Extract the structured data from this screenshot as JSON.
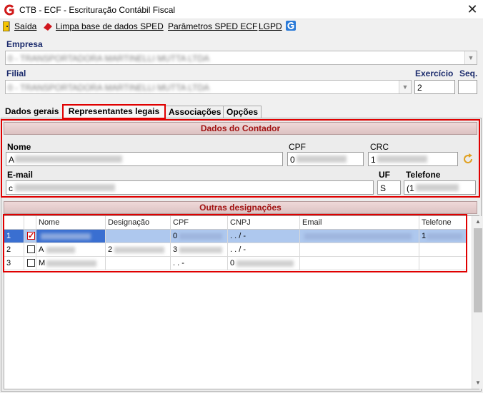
{
  "window": {
    "title": "CTB - ECF - Escrituração Contábil Fiscal",
    "close_label": "✕"
  },
  "menu": {
    "saida": "Saída",
    "limpa": "Limpa base de dados SPED",
    "parametros": "Parâmetros SPED ECF",
    "lgpd": "LGPD"
  },
  "empresa": {
    "label": "Empresa",
    "value": "0 - TRANSPORTADORA MARTINELLI MUTTA LTDA"
  },
  "filial": {
    "label": "Filial",
    "value": "0 - TRANSPORTADORA MARTINELLI MUTTA LTDA"
  },
  "exercicio": {
    "label": "Exercício",
    "value": "2"
  },
  "seq": {
    "label": "Seq.",
    "value": ""
  },
  "tabs": [
    {
      "label": "Dados gerais"
    },
    {
      "label": "Representantes legais"
    },
    {
      "label": "Associações"
    },
    {
      "label": "Opções"
    }
  ],
  "contador": {
    "header": "Dados do Contador",
    "nome_label": "Nome",
    "nome_value": "A",
    "cpf_label": "CPF",
    "cpf_value": "0",
    "crc_label": "CRC",
    "crc_value": "1",
    "email_label": "E-mail",
    "email_value": "c",
    "uf_label": "UF",
    "uf_value": "S",
    "telefone_label": "Telefone",
    "telefone_value": "(1"
  },
  "outras": {
    "header": "Outras designações",
    "columns": [
      "Nome",
      "Designação",
      "CPF",
      "CNPJ",
      "Email",
      "Telefone"
    ],
    "rows": [
      {
        "n": "1",
        "checked": true,
        "nome": "",
        "designacao": "",
        "cpf": "0",
        "cnpj": " .   .   /   -",
        "email": "",
        "telefone": "1"
      },
      {
        "n": "2",
        "checked": false,
        "nome": "A",
        "designacao": "2",
        "cpf": "3",
        "cnpj": " .   .   /   -",
        "email": "",
        "telefone": ""
      },
      {
        "n": "3",
        "checked": false,
        "nome": "M",
        "designacao": "",
        "cpf": " .   .   -",
        "cnpj": "0",
        "email": "",
        "telefone": ""
      }
    ]
  },
  "colors": {
    "accent_red": "#e00000",
    "header_text": "#a11212",
    "label_blue": "#1a2a6c"
  }
}
